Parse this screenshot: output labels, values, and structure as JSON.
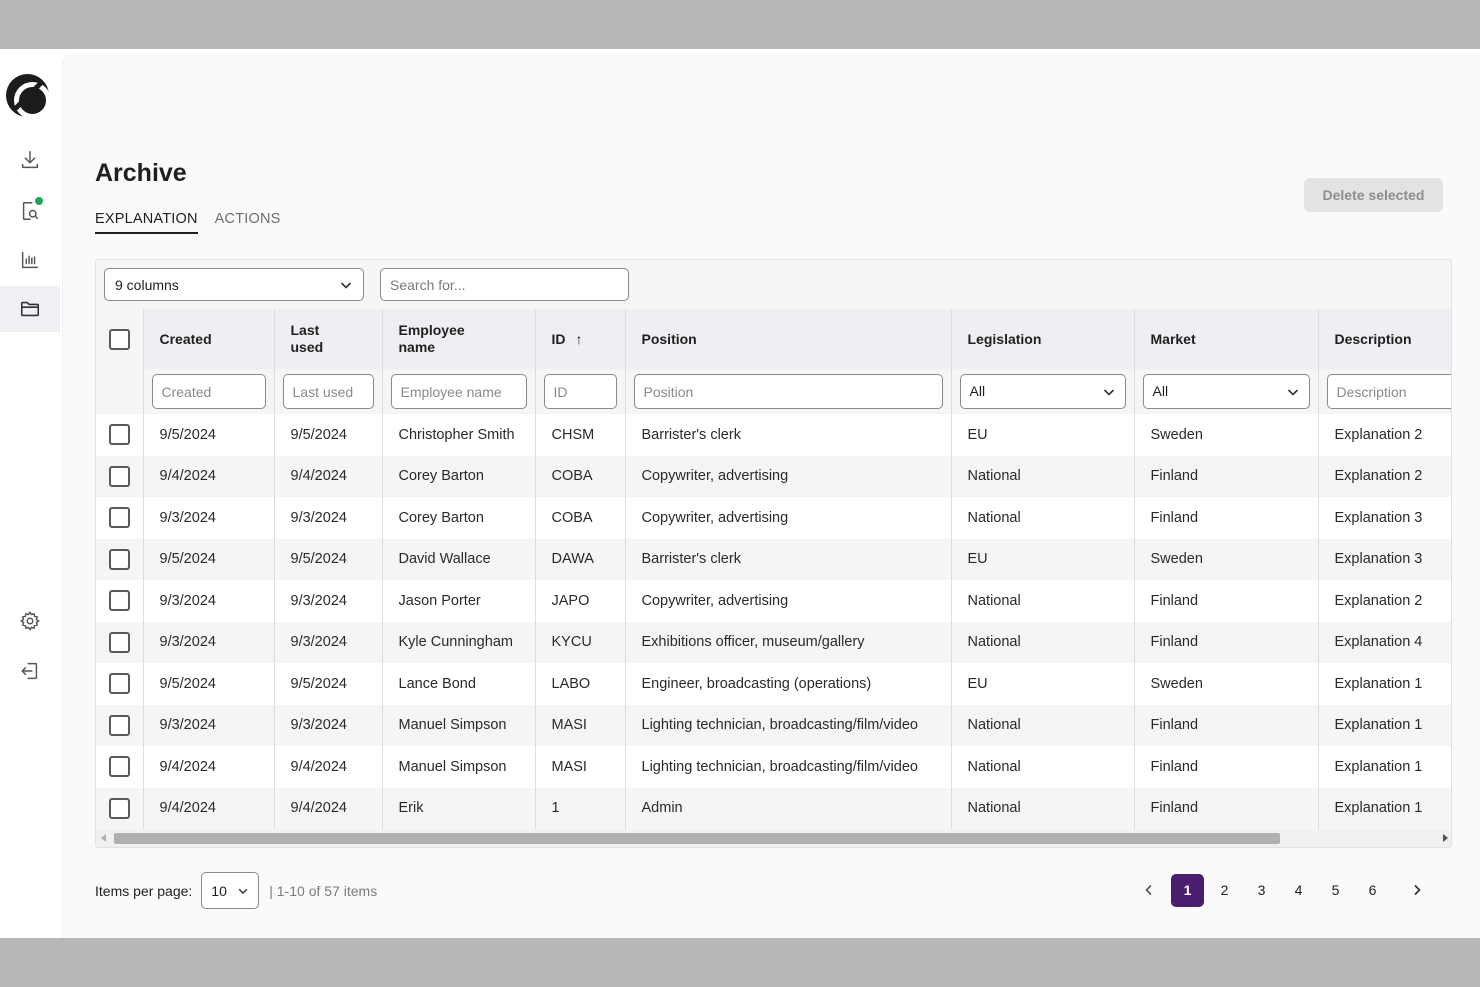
{
  "sidebar": {
    "items": [
      {
        "icon": "download-icon"
      },
      {
        "icon": "document-search-icon",
        "badge_color": "#23a35a"
      },
      {
        "icon": "bar-chart-icon"
      },
      {
        "icon": "folder-icon",
        "active": true
      },
      {
        "icon": "gear-icon"
      },
      {
        "icon": "logout-icon"
      }
    ]
  },
  "page": {
    "title": "Archive",
    "tabs": [
      {
        "label": "EXPLANATION",
        "active": true
      },
      {
        "label": "ACTIONS",
        "active": false
      }
    ],
    "delete_label": "Delete selected"
  },
  "toolbar": {
    "columns_value": "9 columns",
    "search_placeholder": "Search for..."
  },
  "table": {
    "headers": [
      "Created",
      "Last used",
      "Employee name",
      "ID",
      "Position",
      "Legislation",
      "Market",
      "Description"
    ],
    "sort": {
      "column": "ID",
      "direction": "asc"
    },
    "filters": {
      "created": "Created",
      "last_used": "Last used",
      "employee_name": "Employee name",
      "id": "ID",
      "position": "Position",
      "legislation": "All",
      "market": "All",
      "description": "Description"
    },
    "rows": [
      [
        "9/5/2024",
        "9/5/2024",
        "Christopher Smith",
        "CHSM",
        "Barrister's clerk",
        "EU",
        "Sweden",
        "Explanation 2"
      ],
      [
        "9/4/2024",
        "9/4/2024",
        "Corey Barton",
        "COBA",
        "Copywriter, advertising",
        "National",
        "Finland",
        "Explanation 2"
      ],
      [
        "9/3/2024",
        "9/3/2024",
        "Corey Barton",
        "COBA",
        "Copywriter, advertising",
        "National",
        "Finland",
        "Explanation 3"
      ],
      [
        "9/5/2024",
        "9/5/2024",
        "David Wallace",
        "DAWA",
        "Barrister's clerk",
        "EU",
        "Sweden",
        "Explanation 3"
      ],
      [
        "9/3/2024",
        "9/3/2024",
        "Jason Porter",
        "JAPO",
        "Copywriter, advertising",
        "National",
        "Finland",
        "Explanation 2"
      ],
      [
        "9/3/2024",
        "9/3/2024",
        "Kyle Cunningham",
        "KYCU",
        "Exhibitions officer, museum/gallery",
        "National",
        "Finland",
        "Explanation 4"
      ],
      [
        "9/5/2024",
        "9/5/2024",
        "Lance Bond",
        "LABO",
        "Engineer, broadcasting (operations)",
        "EU",
        "Sweden",
        "Explanation 1"
      ],
      [
        "9/3/2024",
        "9/3/2024",
        "Manuel Simpson",
        "MASI",
        "Lighting technician, broadcasting/film/video",
        "National",
        "Finland",
        "Explanation 1"
      ],
      [
        "9/4/2024",
        "9/4/2024",
        "Manuel Simpson",
        "MASI",
        "Lighting technician, broadcasting/film/video",
        "National",
        "Finland",
        "Explanation 1"
      ],
      [
        "9/4/2024",
        "9/4/2024",
        "Erik",
        "1",
        "Admin",
        "National",
        "Finland",
        "Explanation 1"
      ]
    ]
  },
  "footer": {
    "items_per_page_label": "Items per page:",
    "items_per_page_value": "10",
    "range_text": "|  1-10 of 57 items",
    "pages": [
      "1",
      "2",
      "3",
      "4",
      "5",
      "6"
    ],
    "current_page": "1"
  },
  "colors": {
    "accent": "#4a1d6e",
    "header_bg": "#f0eef3",
    "badge": "#23a35a"
  }
}
